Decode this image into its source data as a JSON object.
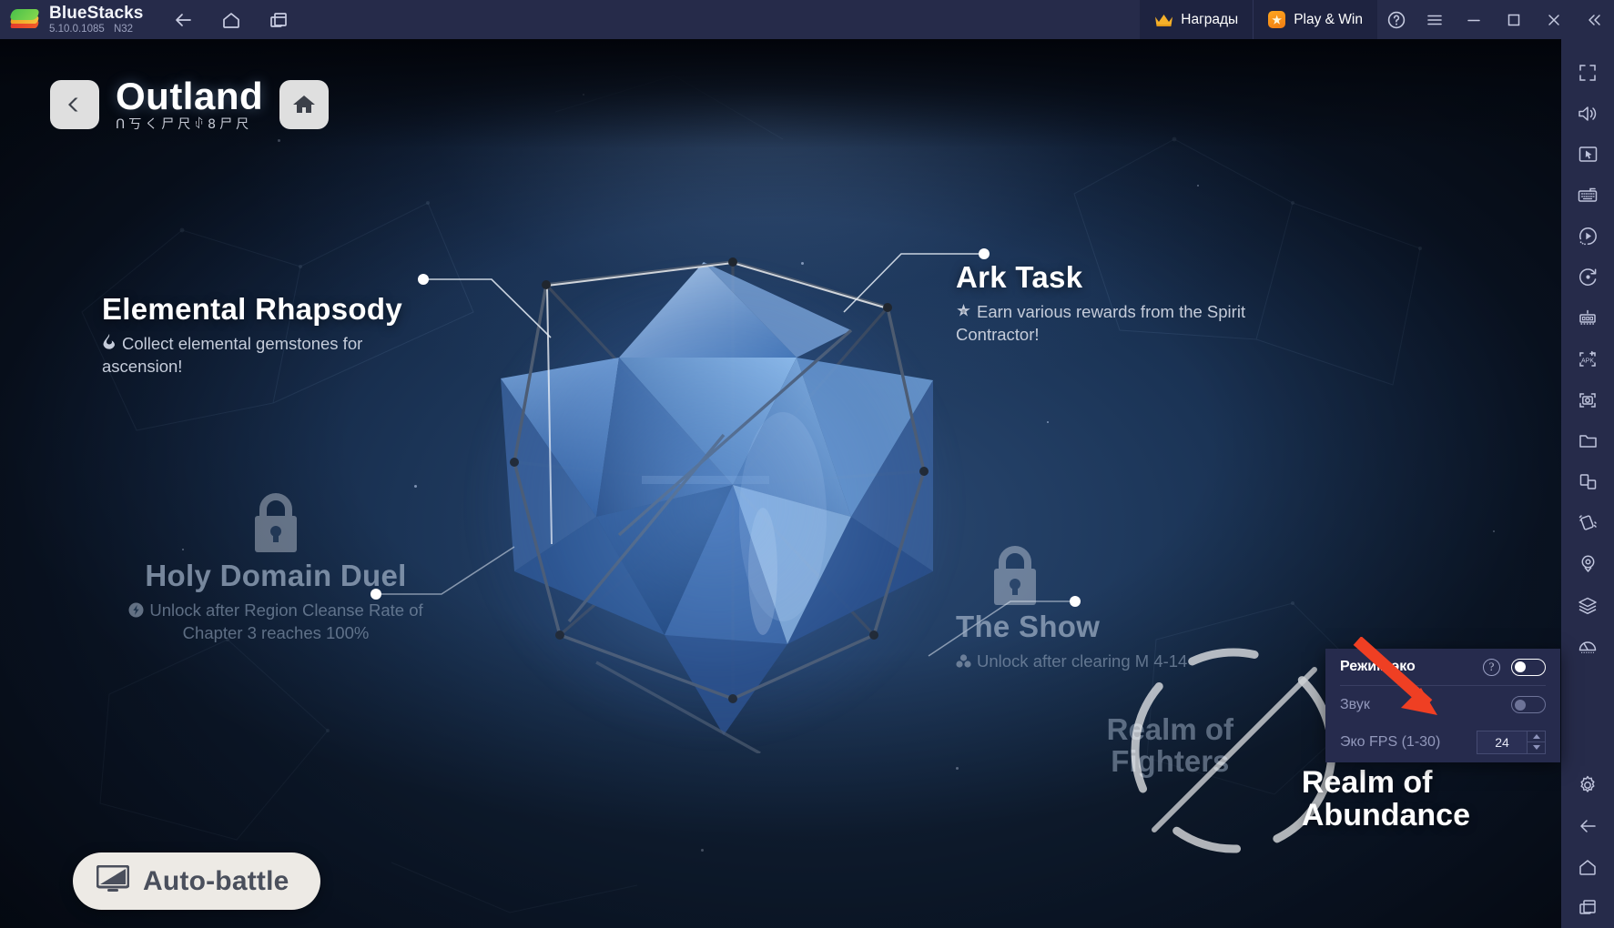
{
  "window": {
    "app_name": "BlueStacks",
    "version": "5.10.0.1085",
    "instance": "N32",
    "nav": [
      {
        "name": "back",
        "icon": "arrow-left-icon"
      },
      {
        "name": "home",
        "icon": "home-icon"
      },
      {
        "name": "multi-instance",
        "icon": "windows-icon"
      }
    ],
    "rewards_label": "Награды",
    "playwin_label": "Play & Win",
    "help_icon": "help-circle-icon",
    "menu_icon": "hamburger-menu-icon",
    "minimize_icon": "minimize-icon",
    "maximize_icon": "maximize-icon",
    "close_icon": "close-icon",
    "collapse_icon": "double-chevron-left-icon"
  },
  "game": {
    "title": "Outland",
    "subtitle": "ᑎ丂く尸尺ꂑ8尸尺",
    "back_icon": "chevron-left-icon",
    "home_icon": "house-icon",
    "auto_battle": {
      "label": "Auto-battle",
      "icon": "monitor-icon"
    },
    "nodes": [
      {
        "id": "elemental-rhapsody",
        "title": "Elemental Rhapsody",
        "desc": "Collect elemental gemstones for ascension!",
        "icon": "flame-icon",
        "locked": false
      },
      {
        "id": "ark-task",
        "title": "Ark Task",
        "desc": "Earn various rewards from the Spirit Contractor!",
        "icon": "star-icon",
        "locked": false
      },
      {
        "id": "holy-domain-duel",
        "title": "Holy Domain Duel",
        "desc": "Unlock after Region Cleanse Rate of Chapter 3 reaches 100%",
        "icon": "bolt-icon",
        "locked": true
      },
      {
        "id": "the-show",
        "title": "The Show",
        "desc": "Unlock after clearing M 4-14",
        "icon": "cluster-icon",
        "locked": true
      }
    ],
    "realm_fighters": {
      "line1": "Realm of",
      "line2": "Fighters"
    },
    "realm_abundance": {
      "line1": "Realm of",
      "line2": "Abundance"
    }
  },
  "eco_popup": {
    "title": "Режим эко",
    "help_icon": "help-circle-icon",
    "eco_toggle_state": "on",
    "sound_label": "Звук",
    "sound_toggle_state": "off",
    "fps_label": "Эко FPS (1-30)",
    "fps_value": "24"
  },
  "sidebar": {
    "items": [
      {
        "name": "fullscreen-icon"
      },
      {
        "name": "volume-icon"
      },
      {
        "name": "cursor-control-icon"
      },
      {
        "name": "keyboard-controls-icon"
      },
      {
        "name": "macro-recorder-icon"
      },
      {
        "name": "rotate-icon"
      },
      {
        "name": "game-guide-icon"
      },
      {
        "name": "install-apk-icon"
      },
      {
        "name": "screenshot-icon"
      },
      {
        "name": "media-folder-icon"
      },
      {
        "name": "multi-instance-sync-icon"
      },
      {
        "name": "shake-icon"
      },
      {
        "name": "location-icon"
      },
      {
        "name": "layers-icon"
      },
      {
        "name": "eco-mode-icon"
      }
    ],
    "bottom_items": [
      {
        "name": "settings-gear-icon"
      },
      {
        "name": "back-arrow-icon"
      },
      {
        "name": "home-icon"
      },
      {
        "name": "recent-apps-icon"
      }
    ]
  },
  "colors": {
    "chrome": "#262b4a",
    "accent_orange": "#f0901e",
    "arrow_red": "#ef3f23",
    "panel": "#262b4d"
  }
}
